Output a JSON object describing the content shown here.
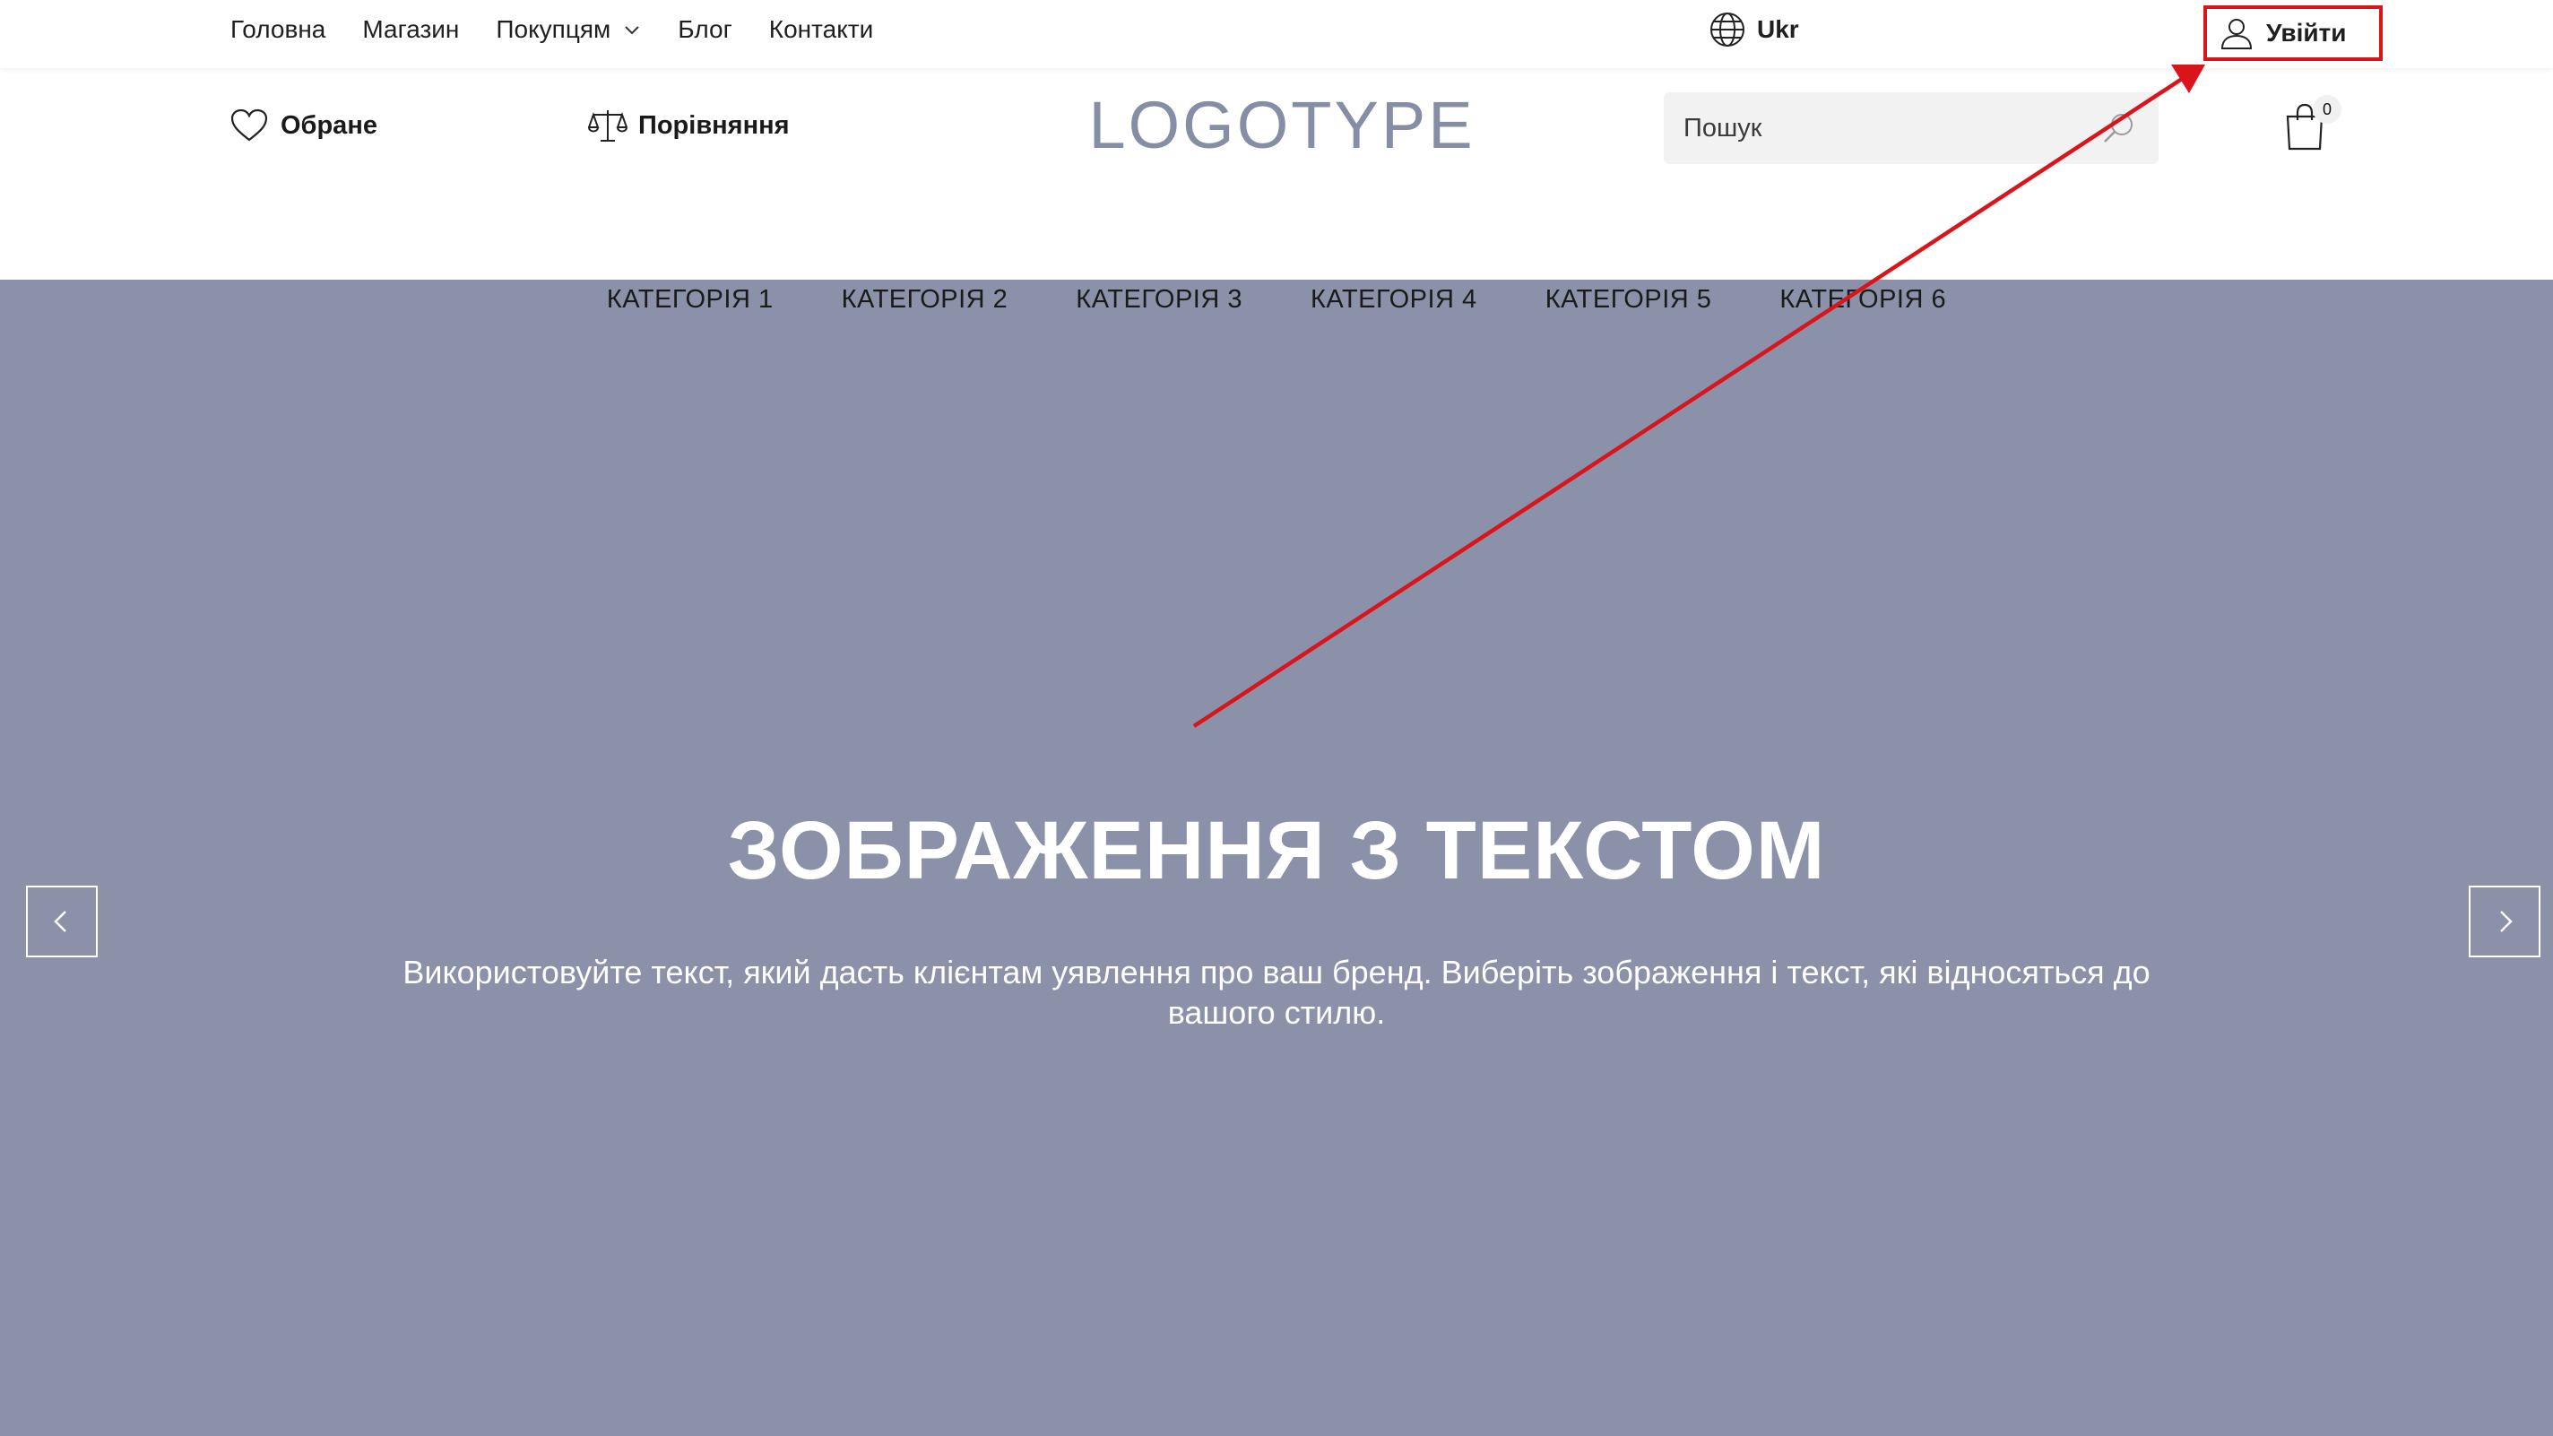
{
  "topbar": {
    "nav": [
      {
        "label": "Головна",
        "has_dropdown": false
      },
      {
        "label": "Магазин",
        "has_dropdown": false
      },
      {
        "label": "Покупцям",
        "has_dropdown": true
      },
      {
        "label": "Блог",
        "has_dropdown": false
      },
      {
        "label": "Контакти",
        "has_dropdown": false
      }
    ],
    "language": {
      "label": "Ukr",
      "icon": "globe-icon"
    },
    "login": {
      "label": "Увійти",
      "icon": "user-icon",
      "highlight_color": "#d9141b"
    }
  },
  "header": {
    "favorites": {
      "label": "Обране",
      "icon": "heart-icon"
    },
    "compare": {
      "label": "Порівняння",
      "icon": "scales-icon"
    },
    "logo": "LOGOTYPE",
    "search": {
      "placeholder": "Пошук",
      "value": "",
      "icon": "search-icon"
    },
    "cart": {
      "count": "0",
      "icon": "shopping-bag-icon"
    }
  },
  "categories": [
    "КАТЕГОРІЯ 1",
    "КАТЕГОРІЯ 2",
    "КАТЕГОРІЯ 3",
    "КАТЕГОРІЯ 4",
    "КАТЕГОРІЯ 5",
    "КАТЕГОРІЯ 6"
  ],
  "hero": {
    "title": "ЗОБРАЖЕННЯ З ТЕКСТОМ",
    "text": "Використовуйте текст, який дасть клієнтам уявлення про ваш бренд. Виберіть зображення і текст, які відносяться до вашого стилю.",
    "background": "#8a91a8",
    "prev_icon": "chevron-left-icon",
    "next_icon": "chevron-right-icon"
  },
  "colors": {
    "logo": "#858ea5",
    "annotation": "#d9141b",
    "text": "#1a1a1a"
  }
}
